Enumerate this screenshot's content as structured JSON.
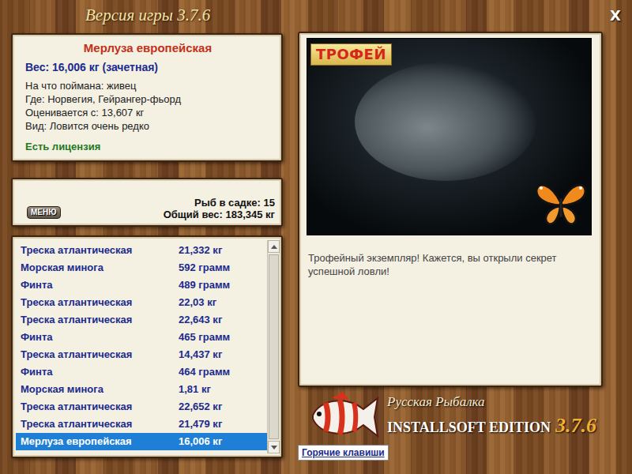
{
  "window": {
    "title": "Версия игры 3.7.6",
    "close": "X"
  },
  "catch": {
    "name": "Мерлуза европейская",
    "weight": "Вес: 16,006 кг (зачетная)",
    "details": [
      "На что поймана: живец",
      "Где: Норвегия, Гейрангер-фьорд",
      "Оценивается с: 13,607 кг",
      "Вид: Ловится очень редко"
    ],
    "license": "Есть лицензия"
  },
  "keepnet": {
    "menu_button": "МЕНЮ",
    "count": "Рыб в садке: 15",
    "total": "Общий вес: 183,345 кг"
  },
  "list": {
    "rows": [
      {
        "name": "Треска атлантическая",
        "weight": "21,332 кг",
        "selected": false
      },
      {
        "name": "Морская минога",
        "weight": "592 грамм",
        "selected": false
      },
      {
        "name": "Финта",
        "weight": "489 грамм",
        "selected": false
      },
      {
        "name": "Треска атлантическая",
        "weight": "22,03 кг",
        "selected": false
      },
      {
        "name": "Треска атлантическая",
        "weight": "22,643 кг",
        "selected": false
      },
      {
        "name": "Финта",
        "weight": "465 грамм",
        "selected": false
      },
      {
        "name": "Треска атлантическая",
        "weight": "14,437 кг",
        "selected": false
      },
      {
        "name": "Финта",
        "weight": "464 грамм",
        "selected": false
      },
      {
        "name": "Морская минога",
        "weight": "1,81 кг",
        "selected": false
      },
      {
        "name": "Треска атлантическая",
        "weight": "22,652 кг",
        "selected": false
      },
      {
        "name": "Треска атлантическая",
        "weight": "21,479 кг",
        "selected": false
      },
      {
        "name": "Мерлуза европейская",
        "weight": "16,006 кг",
        "selected": true
      }
    ]
  },
  "photo": {
    "badge": "ТРОФЕЙ"
  },
  "message": "Трофейный экземпляр! Кажется, вы открыли секрет успешной ловли!",
  "logo": {
    "title": "Русская Рыбалка",
    "edition": "INSTALLSOFT EDITION",
    "version": "3.7.6"
  },
  "hotkeys_button": "Горячие клавиши"
}
